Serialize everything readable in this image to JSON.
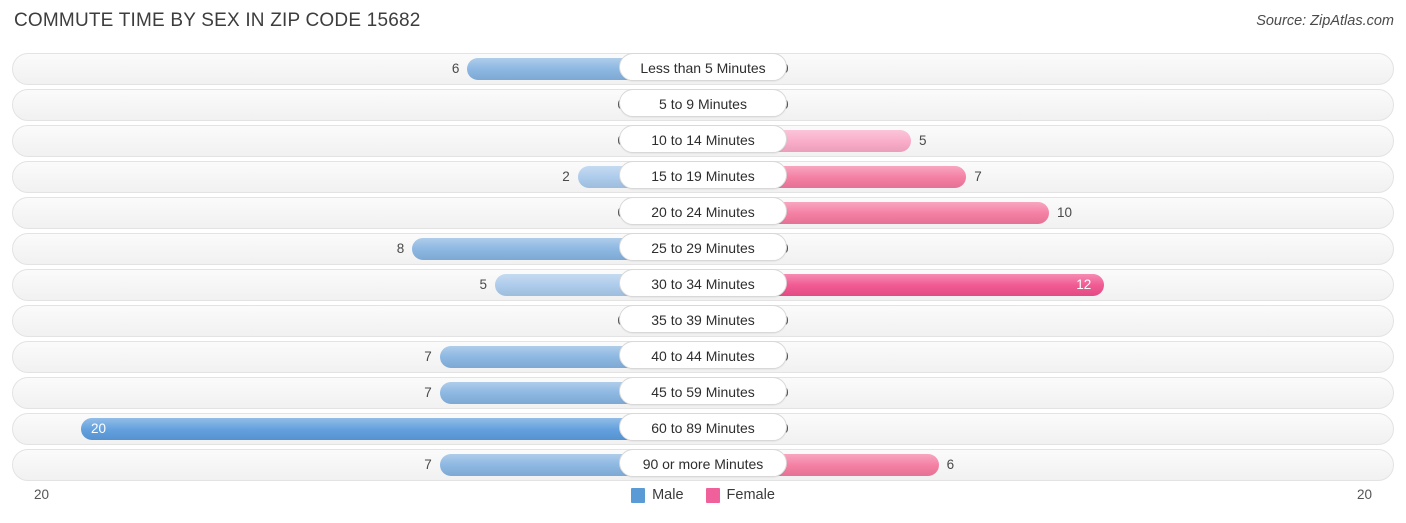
{
  "header": {
    "title": "COMMUTE TIME BY SEX IN ZIP CODE 15682",
    "source": "Source: ZipAtlas.com"
  },
  "legend": {
    "male_label": "Male",
    "female_label": "Female",
    "male_color": "#5b9bd5",
    "female_color": "#f0609a"
  },
  "axis": {
    "left_label": "20",
    "right_label": "20"
  },
  "chart_data": {
    "type": "bar",
    "subtype": "diverging-bidirectional",
    "title": "COMMUTE TIME BY SEX IN ZIP CODE 15682",
    "xlabel": "",
    "ylabel": "",
    "axis_max": 20,
    "grid": false,
    "legend_position": "bottom-center",
    "categories": [
      "Less than 5 Minutes",
      "5 to 9 Minutes",
      "10 to 14 Minutes",
      "15 to 19 Minutes",
      "20 to 24 Minutes",
      "25 to 29 Minutes",
      "30 to 34 Minutes",
      "35 to 39 Minutes",
      "40 to 44 Minutes",
      "45 to 59 Minutes",
      "60 to 89 Minutes",
      "90 or more Minutes"
    ],
    "series": [
      {
        "name": "Male",
        "color": "#5b9bd5",
        "direction": "left",
        "values": [
          6,
          0,
          0,
          2,
          0,
          8,
          5,
          0,
          7,
          7,
          20,
          7
        ]
      },
      {
        "name": "Female",
        "color": "#f0609a",
        "direction": "right",
        "values": [
          0,
          0,
          5,
          7,
          10,
          0,
          12,
          0,
          0,
          0,
          0,
          6
        ]
      }
    ],
    "rows": [
      {
        "category": "Less than 5 Minutes",
        "male": 6,
        "female": 0,
        "male_text": "6",
        "female_text": "0"
      },
      {
        "category": "5 to 9 Minutes",
        "male": 0,
        "female": 0,
        "male_text": "0",
        "female_text": "0"
      },
      {
        "category": "10 to 14 Minutes",
        "male": 0,
        "female": 5,
        "male_text": "0",
        "female_text": "5"
      },
      {
        "category": "15 to 19 Minutes",
        "male": 2,
        "female": 7,
        "male_text": "2",
        "female_text": "7"
      },
      {
        "category": "20 to 24 Minutes",
        "male": 0,
        "female": 10,
        "male_text": "0",
        "female_text": "10"
      },
      {
        "category": "25 to 29 Minutes",
        "male": 8,
        "female": 0,
        "male_text": "8",
        "female_text": "0"
      },
      {
        "category": "30 to 34 Minutes",
        "male": 5,
        "female": 12,
        "male_text": "5",
        "female_text": "12"
      },
      {
        "category": "35 to 39 Minutes",
        "male": 0,
        "female": 0,
        "male_text": "0",
        "female_text": "0"
      },
      {
        "category": "40 to 44 Minutes",
        "male": 7,
        "female": 0,
        "male_text": "7",
        "female_text": "0"
      },
      {
        "category": "45 to 59 Minutes",
        "male": 7,
        "female": 0,
        "male_text": "7",
        "female_text": "0"
      },
      {
        "category": "60 to 89 Minutes",
        "male": 20,
        "female": 0,
        "male_text": "20",
        "female_text": "0"
      },
      {
        "category": "90 or more Minutes",
        "male": 7,
        "female": 6,
        "male_text": "7",
        "female_text": "6"
      }
    ]
  }
}
